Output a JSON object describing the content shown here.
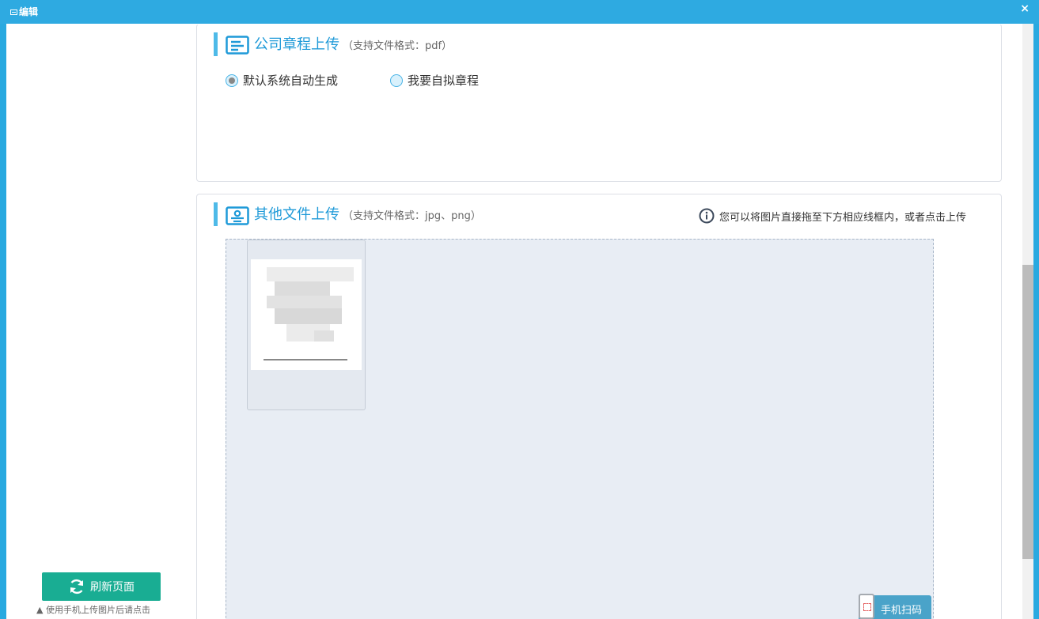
{
  "window": {
    "title": "编辑",
    "close_glyph": "×",
    "icon": "window-icon"
  },
  "section_charter": {
    "title": "公司章程上传",
    "hint": "（支持文件格式：pdf）",
    "icon": "document-icon",
    "options": [
      {
        "label": "默认系统自动生成",
        "checked": true
      },
      {
        "label": "我要自拟章程",
        "checked": false
      }
    ]
  },
  "section_other": {
    "title": "其他文件上传",
    "hint": "（支持文件格式：jpg、png）",
    "icon": "id-card-icon",
    "tip": "您可以将图片直接拖至下方相应线框内，或者点击上传",
    "tip_icon": "info-icon"
  },
  "sidebar": {
    "refresh_label": "刷新页面",
    "refresh_note": "▲ 使用手机上传图片后请点击"
  },
  "scan_button": {
    "label": "手机扫码",
    "icon": "phone-qr-icon"
  },
  "colors": {
    "accent": "#2eaae1",
    "title_blue": "#1f9ad8",
    "refresh_green": "#19ad93"
  }
}
